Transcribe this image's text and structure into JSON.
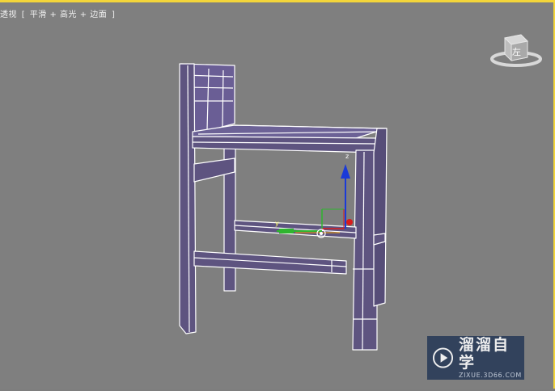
{
  "viewport": {
    "label_parts": [
      "透视",
      "[",
      "平滑 + 高光 + 边面",
      "]"
    ],
    "border_color": "#f3d53a",
    "background_color": "#7f7f7f"
  },
  "viewcube": {
    "face_label": "左"
  },
  "scene": {
    "object": "chair",
    "mesh_color": "#5e5480",
    "wire_color": "#ffffff",
    "gizmo": {
      "z_label": "z",
      "y_label": "y",
      "x_color": "#d81c1c",
      "y_color": "#2fb52f",
      "z_color": "#1a3ad8"
    }
  },
  "watermark": {
    "name": "溜溜自学",
    "site": "ZIXUE.3D66.COM"
  }
}
